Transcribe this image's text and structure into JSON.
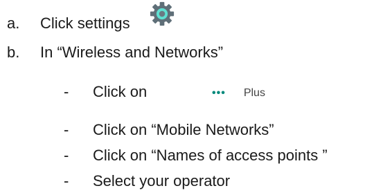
{
  "steps": [
    {
      "marker": "a.",
      "text": "Click settings"
    },
    {
      "marker": "b.",
      "text": "In “Wireless and Networks”"
    }
  ],
  "substeps": [
    {
      "marker": "-",
      "text": "Click on"
    },
    {
      "marker": "-",
      "text": "Click on “Mobile Networks”"
    },
    {
      "marker": "-",
      "text": "Click on “Names of access points ”"
    },
    {
      "marker": "-",
      "text": "Select your operator"
    }
  ],
  "overflow_menu": {
    "dots": "•••",
    "label": "Plus"
  },
  "icons": {
    "settings": "gear-icon",
    "overflow": "three-dots-icon"
  },
  "colors": {
    "gear_outer": "#5f6f78",
    "gear_inner": "#5fe0d2",
    "dots": "#00897b"
  }
}
